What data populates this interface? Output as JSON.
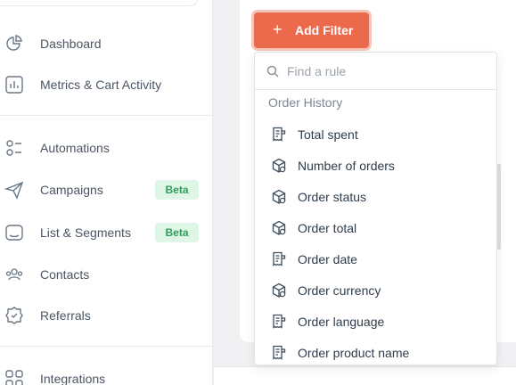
{
  "sidebar": {
    "items": [
      {
        "label": "Dashboard",
        "icon": "pie-chart-icon"
      },
      {
        "label": "Metrics & Cart Activity",
        "icon": "bar-chart-icon"
      },
      {
        "label": "Automations",
        "icon": "automation-icon"
      },
      {
        "label": "Campaigns",
        "icon": "send-icon",
        "badge": "Beta"
      },
      {
        "label": "List & Segments",
        "icon": "folder-icon",
        "badge": "Beta"
      },
      {
        "label": "Contacts",
        "icon": "contacts-icon"
      },
      {
        "label": "Referrals",
        "icon": "referral-icon"
      },
      {
        "label": "Integrations",
        "icon": "integrations-icon"
      }
    ]
  },
  "toolbar": {
    "add_filter_label": "Add Filter",
    "plus_glyph": "+"
  },
  "dropdown": {
    "search_placeholder": "Find a rule",
    "group_title": "Order History",
    "rules": [
      {
        "label": "Total spent",
        "icon": "receipt-icon"
      },
      {
        "label": "Number of orders",
        "icon": "box-icon"
      },
      {
        "label": "Order status",
        "icon": "box-icon"
      },
      {
        "label": "Order total",
        "icon": "box-icon"
      },
      {
        "label": "Order date",
        "icon": "receipt-icon"
      },
      {
        "label": "Order currency",
        "icon": "box-icon"
      },
      {
        "label": "Order language",
        "icon": "receipt-icon"
      },
      {
        "label": "Order product name",
        "icon": "receipt-icon"
      }
    ]
  },
  "colors": {
    "accent": "#ec6a4c",
    "badge_bg": "#dff5e6",
    "badge_text": "#2f9e5a"
  }
}
